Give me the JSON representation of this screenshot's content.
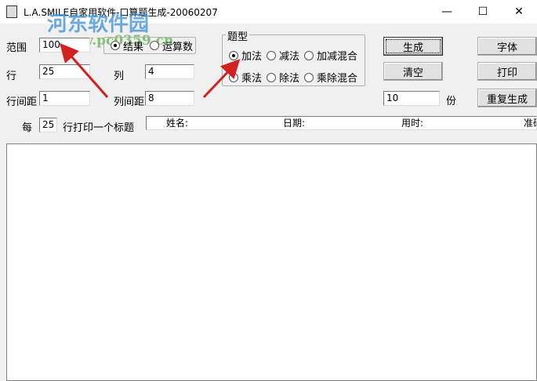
{
  "window": {
    "title": "L.A.SMILE自家用软件-口算题生成-20060207",
    "minimize": "—",
    "maximize": "☐",
    "close": "✕"
  },
  "watermark": {
    "name": "河东软件园",
    "url": "www.pc0359.cn"
  },
  "form": {
    "range_label": "范围",
    "range_value": "100",
    "show_mode": {
      "options": [
        "结果",
        "运算数"
      ],
      "selected": "结果"
    },
    "rows_label": "行",
    "rows_value": "25",
    "cols_label": "列",
    "cols_value": "4",
    "row_spacing_label": "行间距",
    "row_spacing_value": "1",
    "col_spacing_label": "列间距",
    "col_spacing_value": "8",
    "every_label": "每",
    "every_value": "25",
    "every_suffix": "行打印一个标题",
    "header_fields": [
      "姓名:",
      "日期:",
      "用时:",
      "准确"
    ]
  },
  "question_type": {
    "label": "题型",
    "options": [
      "加法",
      "减法",
      "加减混合",
      "乘法",
      "除法",
      "乘除混合"
    ],
    "selected": "加法"
  },
  "buttons": {
    "generate": "生成",
    "clear": "清空",
    "font": "字体",
    "print": "打印",
    "regenerate": "重复生成"
  },
  "copies": {
    "value": "10",
    "unit": "份"
  },
  "colors": {
    "arrow": "#d42020",
    "watermark": "#3a8fd6"
  }
}
